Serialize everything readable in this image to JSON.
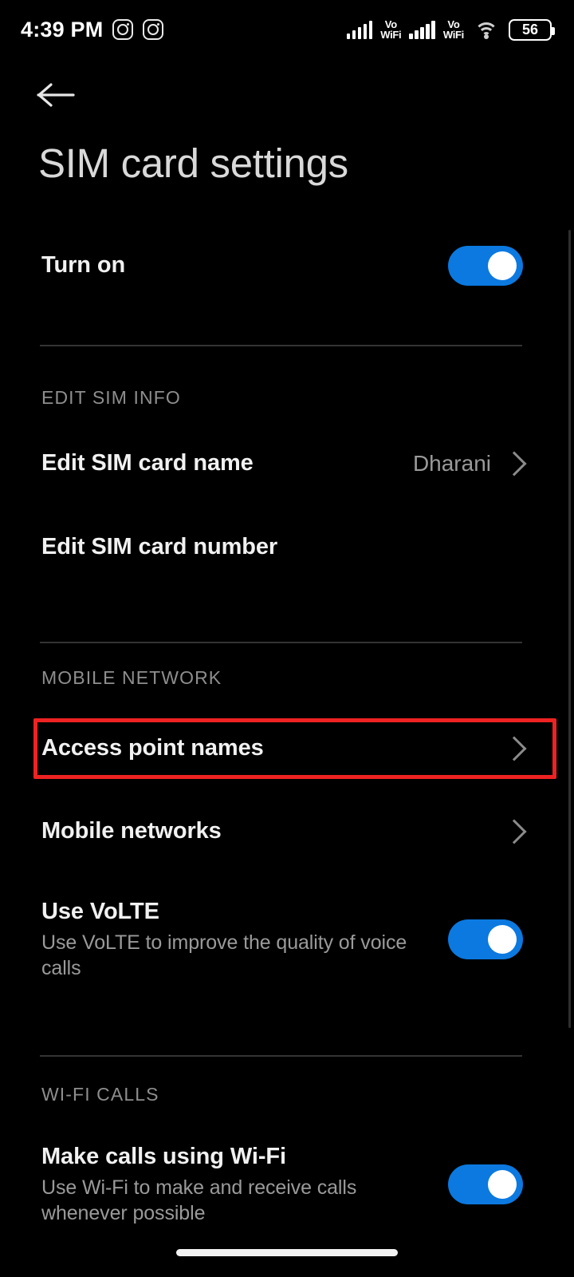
{
  "status_bar": {
    "clock": "4:39 PM",
    "notification_icons": [
      "instagram-icon",
      "instagram-icon"
    ],
    "signal_1": "signal-bars-icon",
    "volte_1_top": "Vo",
    "volte_1_bottom": "WiFi",
    "signal_2": "signal-bars-icon",
    "volte_2_top": "Vo",
    "volte_2_bottom": "WiFi",
    "wifi": "wifi-icon",
    "battery_level": "56"
  },
  "header": {
    "back_icon": "back-arrow-icon",
    "title": "SIM card settings"
  },
  "rows": {
    "turn_on": {
      "title": "Turn on",
      "toggle_state": "on"
    },
    "edit_sim_info_label": "EDIT SIM INFO",
    "edit_sim_card_name": {
      "title": "Edit SIM card name",
      "value": "Dharani"
    },
    "edit_sim_card_number": {
      "title": "Edit SIM card number"
    },
    "mobile_network_label": "MOBILE NETWORK",
    "access_point_names": {
      "title": "Access point names"
    },
    "mobile_networks": {
      "title": "Mobile networks"
    },
    "use_volte": {
      "title": "Use VoLTE",
      "subtitle": "Use VoLTE to improve the quality of voice calls",
      "toggle_state": "on"
    },
    "wifi_calls_label": "WI-FI CALLS",
    "make_calls_using_wifi": {
      "title": "Make calls using Wi-Fi",
      "subtitle": "Use Wi-Fi to make and receive calls whenever possible",
      "toggle_state": "on"
    }
  },
  "colors": {
    "background": "#000000",
    "toggle_on": "#0b79e0",
    "highlight_border": "#ee2222",
    "title_text": "#d9d9d9",
    "secondary_text": "#9a9a9a",
    "divider": "#343434"
  }
}
